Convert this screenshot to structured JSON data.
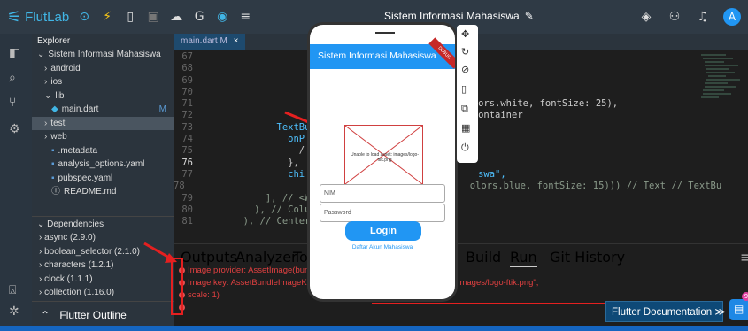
{
  "topbar": {
    "logo_text": "FlutLab",
    "project_title": "Sistem Informasi Mahasiswa",
    "avatar": "A"
  },
  "explorer": {
    "heading": "Explorer",
    "tree": [
      {
        "label": "Sistem Informasi Mahasiswa",
        "indent": 0,
        "prefix": "⌄"
      },
      {
        "label": "android",
        "indent": 1,
        "prefix": "›"
      },
      {
        "label": "ios",
        "indent": 1,
        "prefix": "›"
      },
      {
        "label": "lib",
        "indent": 1,
        "prefix": "⌄"
      },
      {
        "label": "main.dart",
        "indent": 2,
        "prefix": "◆",
        "status": "M"
      },
      {
        "label": "test",
        "indent": 1,
        "prefix": "›",
        "selected": true
      },
      {
        "label": "web",
        "indent": 1,
        "prefix": "›"
      },
      {
        "label": ".metadata",
        "indent": 2,
        "prefix": "▪"
      },
      {
        "label": "analysis_options.yaml",
        "indent": 2,
        "prefix": "▪"
      },
      {
        "label": "pubspec.yaml",
        "indent": 2,
        "prefix": "▪"
      },
      {
        "label": "README.md",
        "indent": 2,
        "prefix": "ⓘ"
      }
    ],
    "dependencies": {
      "heading": "Dependencies",
      "items": [
        "async (2.9.0)",
        "boolean_selector (2.1.0)",
        "characters (1.2.1)",
        "clock (1.1.1)",
        "collection (1.16.0)"
      ]
    },
    "outline_label": "Flutter Outline"
  },
  "editor": {
    "tab_label": "main.dart M",
    "lines": [
      {
        "n": "67",
        "t": ""
      },
      {
        "n": "68",
        "t": ""
      },
      {
        "n": "69",
        "t": ""
      },
      {
        "n": "70",
        "t": ""
      },
      {
        "n": "71",
        "t": "                                                  ors.white, fontSize: 25),"
      },
      {
        "n": "72",
        "t": "                                                  ontainer"
      },
      {
        "n": "73",
        "t": "              TextBut"
      },
      {
        "n": "74",
        "t": "                onP"
      },
      {
        "n": "75",
        "t": "                  /"
      },
      {
        "n": "76",
        "t": "                },"
      },
      {
        "n": "77",
        "t": "                chi                               swa\","
      },
      {
        "n": "78",
        "t": "                                                  olors.blue, fontSize: 15))) // Text // TextBu"
      },
      {
        "n": "79",
        "t": "            ], // <W"
      },
      {
        "n": "80",
        "t": "          ), // Colu"
      },
      {
        "n": "81",
        "t": "        ), // Center"
      }
    ]
  },
  "bottom_panel": {
    "tabs": [
      "Outputs",
      "Analyzer",
      "Tools",
      "Build",
      "Run",
      "Git History"
    ],
    "active_tab": "Run",
    "errors": [
      "Image provider: AssetImage(bundle",
      "Image key: AssetBundleImageKey(b",
      " scale: 1)",
      ""
    ],
    "error_tail": "\"images/logo-ftik.png\","
  },
  "flutter_doc_button": "Flutter Documentation ≫",
  "chat_badge": "9",
  "phone": {
    "app_title": "Sistem Informasi Mahasiswa",
    "debug_banner": "DEBUG",
    "image_error": "Unable to load asset: images/logo-ftik.png",
    "nim_placeholder": "NIM",
    "password_placeholder": "Password",
    "login_label": "Login",
    "register_link": "Daftar Akun Mahasiswa"
  },
  "colors": {
    "accent": "#2196f3",
    "error": "#e04040",
    "arrow": "#e52020"
  }
}
